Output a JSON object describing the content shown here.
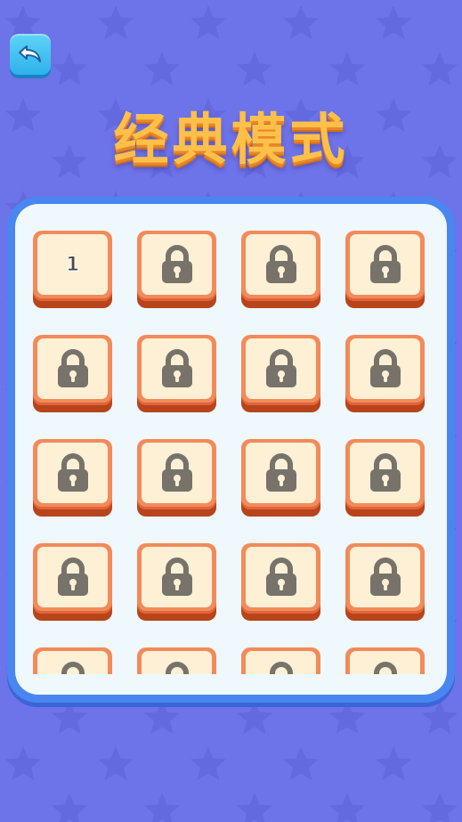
{
  "header": {
    "title": "经典模式",
    "back_icon": "back-arrow-icon"
  },
  "colors": {
    "background": "#6d73e8",
    "panel_border": "#4a86f0",
    "panel_fill": "#eef8fd",
    "tile_face": "#f38a5a",
    "tile_inner": "#fdf0d5",
    "lock": "#77736a",
    "title": "#ffc04a"
  },
  "levels": [
    {
      "label": "1",
      "locked": false
    },
    {
      "label": "",
      "locked": true
    },
    {
      "label": "",
      "locked": true
    },
    {
      "label": "",
      "locked": true
    },
    {
      "label": "",
      "locked": true
    },
    {
      "label": "",
      "locked": true
    },
    {
      "label": "",
      "locked": true
    },
    {
      "label": "",
      "locked": true
    },
    {
      "label": "",
      "locked": true
    },
    {
      "label": "",
      "locked": true
    },
    {
      "label": "",
      "locked": true
    },
    {
      "label": "",
      "locked": true
    },
    {
      "label": "",
      "locked": true
    },
    {
      "label": "",
      "locked": true
    },
    {
      "label": "",
      "locked": true
    },
    {
      "label": "",
      "locked": true
    },
    {
      "label": "",
      "locked": true
    },
    {
      "label": "",
      "locked": true
    },
    {
      "label": "",
      "locked": true
    },
    {
      "label": "",
      "locked": true
    }
  ]
}
